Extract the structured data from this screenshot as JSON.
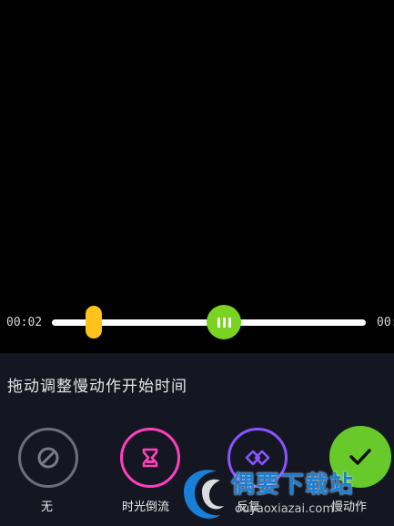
{
  "timeline": {
    "start_time": "00:02",
    "end_time": "00:"
  },
  "panel": {
    "hint": "拖动调整慢动作开始时间",
    "options": [
      {
        "label": "无",
        "icon": "no-effect-icon"
      },
      {
        "label": "时光倒流",
        "icon": "hourglass-icon"
      },
      {
        "label": "反复",
        "icon": "repeat-diamond-icon"
      },
      {
        "label": "慢动作",
        "icon": "check-icon"
      }
    ]
  },
  "watermark": {
    "title": "偶要下载站",
    "url": "ouyaoxiazai.com"
  },
  "colors": {
    "start_handle": "#ffc21a",
    "play_handle": "#7ad321",
    "rewind": "#ff3fbe",
    "repeat": "#8a54ff",
    "slow": "#67c92a"
  }
}
